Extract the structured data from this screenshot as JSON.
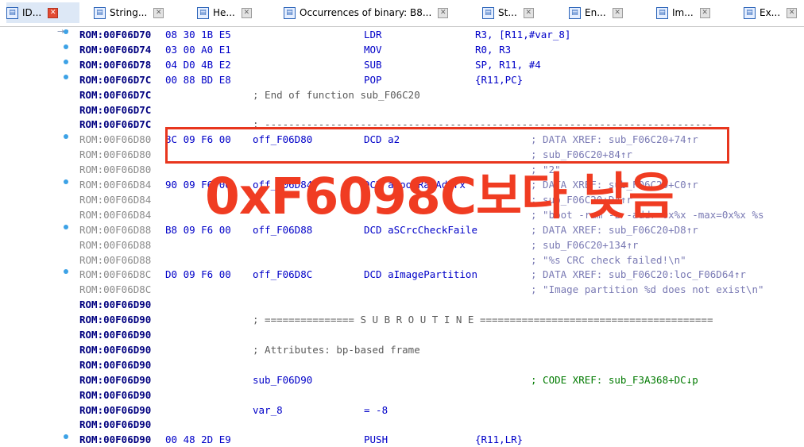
{
  "tabs": [
    {
      "label": "ID...",
      "icon": "ida-view-icon",
      "active": true
    },
    {
      "label": "String...",
      "icon": "strings-icon"
    },
    {
      "label": "He...",
      "icon": "hex-view-icon"
    },
    {
      "label": "Occurrences of binary: B8...",
      "icon": "occurrences-icon"
    },
    {
      "label": "St...",
      "icon": "structures-icon"
    },
    {
      "label": "En...",
      "icon": "enums-icon"
    },
    {
      "label": "Im...",
      "icon": "imports-icon"
    },
    {
      "label": "Ex...",
      "icon": "exports-icon"
    }
  ],
  "overlay_text": "0xF6098C보다 낮음",
  "lines": [
    {
      "addr": "ROM:00F06D70",
      "bytes": "08 30 1B E5",
      "label": "",
      "mn": "LDR",
      "op": "R3, [R11,#var_8]",
      "cm": ""
    },
    {
      "addr": "ROM:00F06D74",
      "bytes": "03 00 A0 E1",
      "label": "",
      "mn": "MOV",
      "op": "R0, R3",
      "cm": ""
    },
    {
      "addr": "ROM:00F06D78",
      "bytes": "04 D0 4B E2",
      "label": "",
      "mn": "SUB",
      "op": "SP, R11, #4",
      "cm": ""
    },
    {
      "addr": "ROM:00F06D7C",
      "bytes": "00 88 BD E8",
      "label": "",
      "mn": "POP",
      "op": "{R11,PC}",
      "cm": ""
    },
    {
      "addr": "ROM:00F06D7C",
      "bytes": "",
      "label": "; End of function sub_F06C20",
      "mn": "",
      "op": "",
      "cm": ""
    },
    {
      "addr": "ROM:00F06D7C",
      "bytes": "",
      "label": "",
      "mn": "",
      "op": "",
      "cm": ""
    },
    {
      "addr": "ROM:00F06D7C",
      "bytes": "",
      "label": "; ---------------------------------------------------------------------------",
      "mn": "",
      "op": "",
      "cm": ""
    },
    {
      "addr": "ROM:00F06D80",
      "bytes": "8C 09 F6 00",
      "label": "off_F06D80",
      "mn": "DCD a2",
      "op": "",
      "cm": "; DATA XREF: sub_F06C20+74↑r"
    },
    {
      "addr": "ROM:00F06D80",
      "bytes": "",
      "label": "",
      "mn": "",
      "op": "",
      "cm": "; sub_F06C20+84↑r"
    },
    {
      "addr": "ROM:00F06D80",
      "bytes": "",
      "label": "",
      "mn": "",
      "op": "",
      "cm": "; \"2\""
    },
    {
      "addr": "ROM:00F06D84",
      "bytes": "90 09 F6 00",
      "label": "off_F06D84",
      "mn": "DCD aBootRamAddrx",
      "op": "",
      "cm": "; DATA XREF: sub_F06C20+C0↑r"
    },
    {
      "addr": "ROM:00F06D84",
      "bytes": "",
      "label": "",
      "mn": "",
      "op": "",
      "cm": "; sub_F06C20+D4↑r"
    },
    {
      "addr": "ROM:00F06D84",
      "bytes": "",
      "label": "",
      "mn": "",
      "op": "",
      "cm": "; \"boot -ram -z -addr=0x%x -max=0x%x %s"
    },
    {
      "addr": "ROM:00F06D88",
      "bytes": "B8 09 F6 00",
      "label": "off_F06D88",
      "mn": "DCD aSCrcCheckFaile",
      "op": "",
      "cm": "; DATA XREF: sub_F06C20+D8↑r"
    },
    {
      "addr": "ROM:00F06D88",
      "bytes": "",
      "label": "",
      "mn": "",
      "op": "",
      "cm": "; sub_F06C20+134↑r"
    },
    {
      "addr": "ROM:00F06D88",
      "bytes": "",
      "label": "",
      "mn": "",
      "op": "",
      "cm": "; \"%s CRC check failed!\\n\""
    },
    {
      "addr": "ROM:00F06D8C",
      "bytes": "D0 09 F6 00",
      "label": "off_F06D8C",
      "mn": "DCD aImagePartition",
      "op": "",
      "cm": "; DATA XREF: sub_F06C20:loc_F06D64↑r"
    },
    {
      "addr": "ROM:00F06D8C",
      "bytes": "",
      "label": "",
      "mn": "",
      "op": "",
      "cm": "; \"Image partition %d does not exist\\n\""
    },
    {
      "addr": "ROM:00F06D90",
      "bytes": "",
      "label": "",
      "mn": "",
      "op": "",
      "cm": ""
    },
    {
      "addr": "ROM:00F06D90",
      "bytes": "",
      "label": "; =============== S U B R O U T I N E =======================================",
      "mn": "",
      "op": "",
      "cm": ""
    },
    {
      "addr": "ROM:00F06D90",
      "bytes": "",
      "label": "",
      "mn": "",
      "op": "",
      "cm": ""
    },
    {
      "addr": "ROM:00F06D90",
      "bytes": "",
      "label": "; Attributes: bp-based frame",
      "mn": "",
      "op": "",
      "cm": ""
    },
    {
      "addr": "ROM:00F06D90",
      "bytes": "",
      "label": "",
      "mn": "",
      "op": "",
      "cm": ""
    },
    {
      "addr": "ROM:00F06D90",
      "bytes": "",
      "label": "sub_F06D90",
      "mn": "",
      "op": "",
      "cm": "; CODE XREF: sub_F3A368+DC↓p"
    },
    {
      "addr": "ROM:00F06D90",
      "bytes": "",
      "label": "",
      "mn": "",
      "op": "",
      "cm": ""
    },
    {
      "addr": "ROM:00F06D90",
      "bytes": "",
      "label": "var_8",
      "mn": "= -8",
      "op": "",
      "cm": ""
    },
    {
      "addr": "ROM:00F06D90",
      "bytes": "",
      "label": "",
      "mn": "",
      "op": "",
      "cm": ""
    },
    {
      "addr": "ROM:00F06D90",
      "bytes": "00 48 2D E9",
      "label": "",
      "mn": "PUSH",
      "op": "{R11,LR}",
      "cm": ""
    }
  ]
}
